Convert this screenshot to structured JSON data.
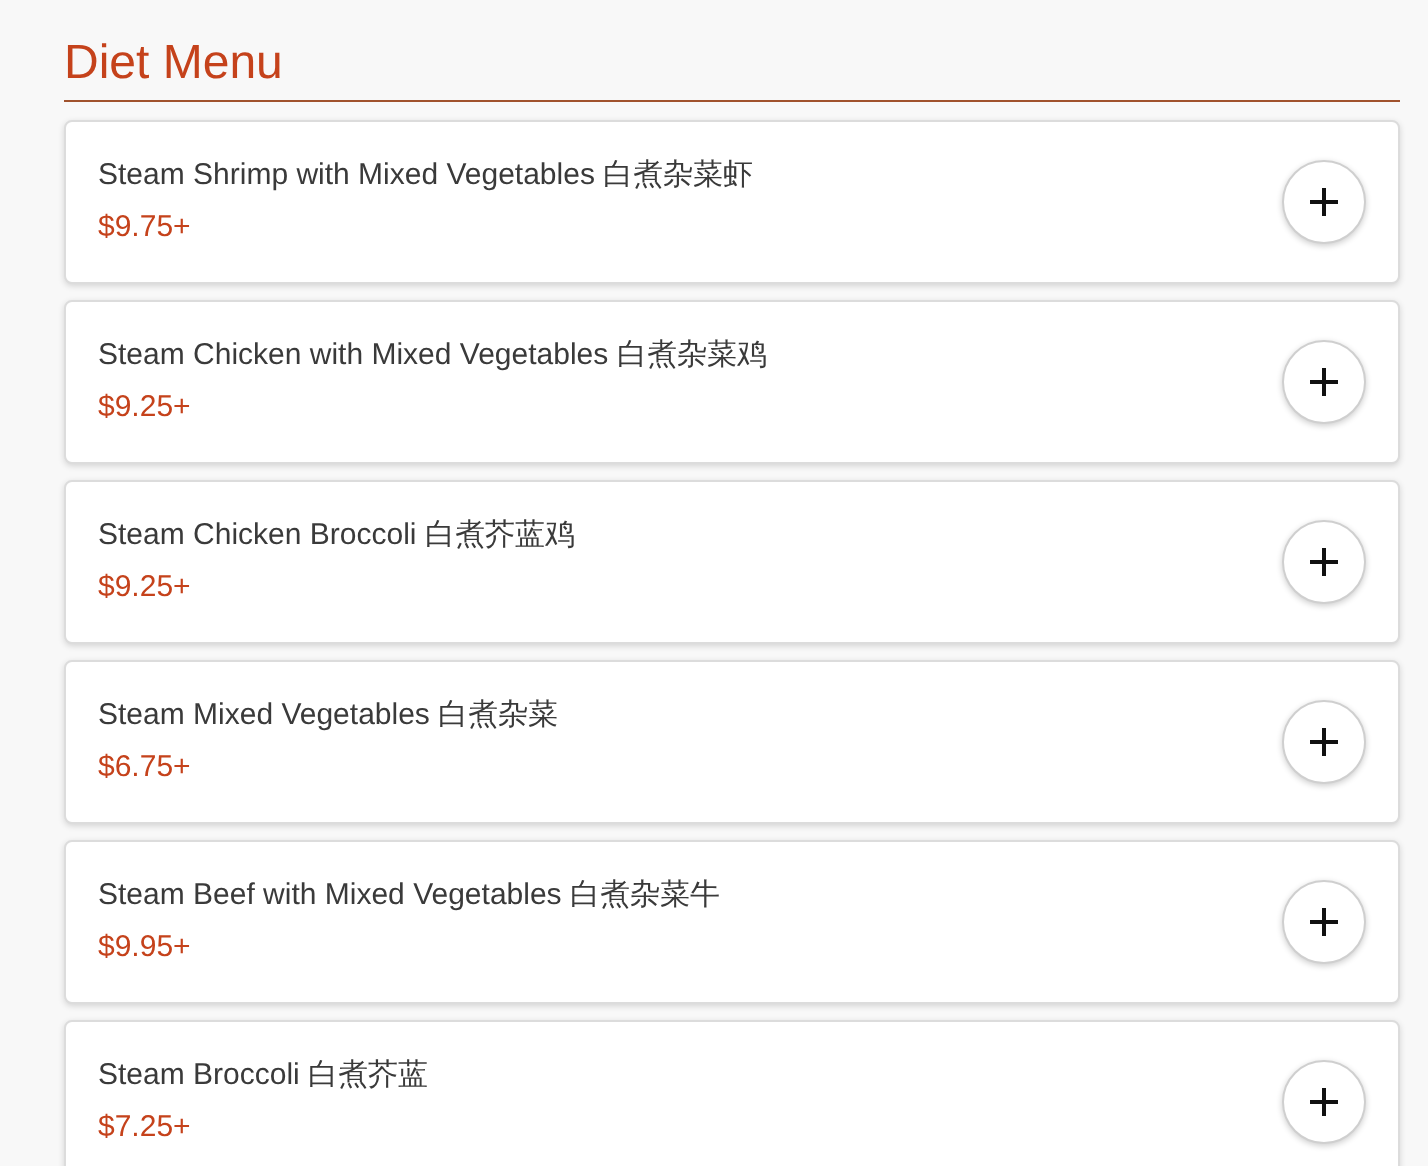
{
  "section": {
    "title": "Diet Menu"
  },
  "items": [
    {
      "name": "Steam Shrimp with Mixed Vegetables 白煮杂菜虾",
      "price": "$9.75+"
    },
    {
      "name": "Steam Chicken with Mixed Vegetables 白煮杂菜鸡",
      "price": "$9.25+"
    },
    {
      "name": "Steam Chicken Broccoli 白煮芥蓝鸡",
      "price": "$9.25+"
    },
    {
      "name": "Steam Mixed Vegetables 白煮杂菜",
      "price": "$6.75+"
    },
    {
      "name": "Steam Beef with Mixed Vegetables 白煮杂菜牛",
      "price": "$9.95+"
    },
    {
      "name": "Steam Broccoli 白煮芥蓝",
      "price": "$7.25+"
    }
  ]
}
